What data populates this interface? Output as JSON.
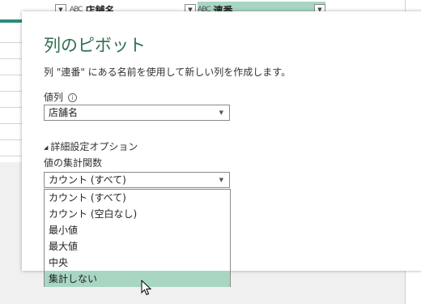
{
  "background": {
    "columns": [
      {
        "type_glyph": "ABC",
        "name": "店舗名"
      },
      {
        "type_glyph": "ABC",
        "name": "連番"
      }
    ]
  },
  "dialog": {
    "title": "列のピボット",
    "description": "列 \"連番\" にある名前を使用して新しい列を作成します。",
    "values_column_label": "値列",
    "info_glyph": "i",
    "values_column_value": "店舗名",
    "advanced_label": "詳細設定オプション",
    "aggregate_label": "値の集計関数",
    "aggregate_value": "カウント (すべて)"
  },
  "dropdown": {
    "options": [
      "カウント (すべて)",
      "カウント (空白なし)",
      "最小値",
      "最大値",
      "中央",
      "集計しない"
    ],
    "hovered_index": 5
  },
  "colors": {
    "accent": "#2f6f4f",
    "highlight": "#a8d6c3",
    "teal": "#2e8b7a"
  }
}
